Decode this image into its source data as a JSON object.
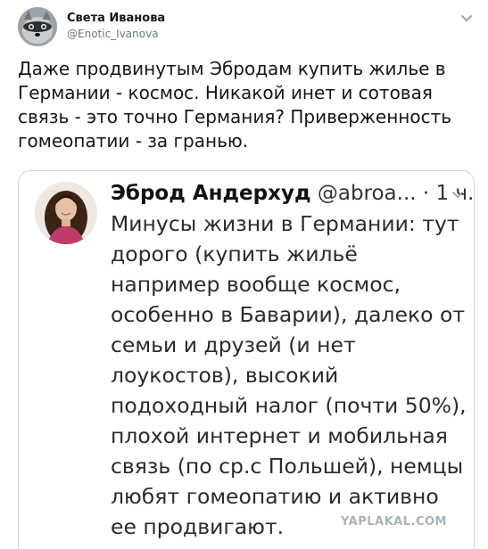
{
  "author": {
    "name": "Света Иванова",
    "handle": "@Enotic_Ivanova",
    "avatar_icon": "raccoon-avatar"
  },
  "tweet": {
    "text": "Даже продвинутым Эбродам купить жилье в Германии - космос. Никакой инет и сотовая связь - это точно Германия? Приверженность гомеопатии - за гранью."
  },
  "quoted": {
    "name": "Эброд Андерхуд",
    "handle": "@abroa...",
    "time": "· 1 ч.",
    "avatar_icon": "woman-avatar",
    "text": "Минусы жизни в Германии: тут дорого (купить жильё например вообще космос, особенно в Баварии), далеко от семьи и друзей (и нет лоукостов), высокий подоходный налог (почти 50%), плохой интернет и мобильная связь (по ср.с Польшей), немцы любят гомеопатию и активно ее продвигают."
  },
  "watermark": {
    "text": "YAPLAKAL.COM"
  },
  "colors": {
    "handle_gray": "#657786",
    "border": "#ccd6dd",
    "text": "#14171a"
  }
}
